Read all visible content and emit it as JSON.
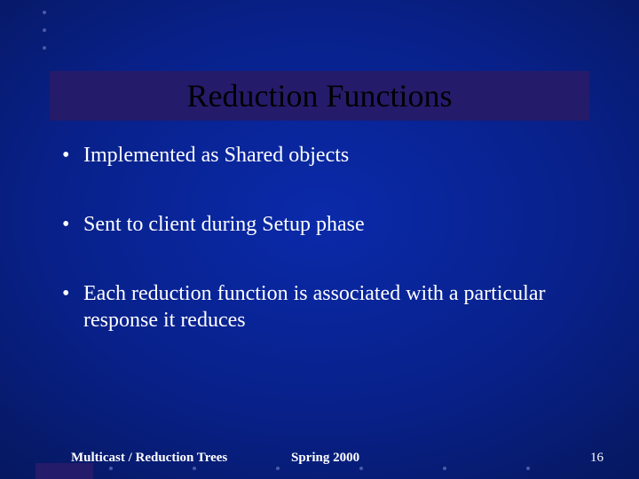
{
  "title": "Reduction Functions",
  "bullets": [
    "Implemented as Shared objects",
    "Sent to client during Setup phase",
    "Each reduction function is associated with a particular response it reduces"
  ],
  "footer": {
    "left": "Multicast / Reduction Trees",
    "center": "Spring 2000",
    "page": "16"
  }
}
